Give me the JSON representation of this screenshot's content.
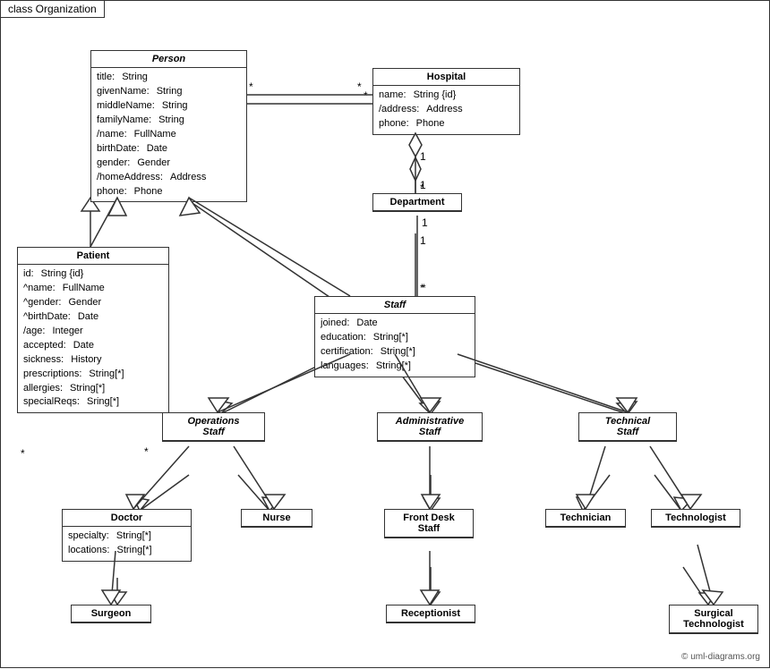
{
  "title": "class Organization",
  "classes": {
    "person": {
      "name": "Person",
      "italic": true,
      "attrs": [
        [
          "title:",
          "String"
        ],
        [
          "givenName:",
          "String"
        ],
        [
          "middleName:",
          "String"
        ],
        [
          "familyName:",
          "String"
        ],
        [
          "/name:",
          "FullName"
        ],
        [
          "birthDate:",
          "Date"
        ],
        [
          "gender:",
          "Gender"
        ],
        [
          "/homeAddress:",
          "Address"
        ],
        [
          "phone:",
          "Phone"
        ]
      ]
    },
    "hospital": {
      "name": "Hospital",
      "italic": false,
      "attrs": [
        [
          "name:",
          "String {id}"
        ],
        [
          "/address:",
          "Address"
        ],
        [
          "phone:",
          "Phone"
        ]
      ]
    },
    "patient": {
      "name": "Patient",
      "italic": false,
      "attrs": [
        [
          "id:",
          "String {id}"
        ],
        [
          "^name:",
          "FullName"
        ],
        [
          "^gender:",
          "Gender"
        ],
        [
          "^birthDate:",
          "Date"
        ],
        [
          "/age:",
          "Integer"
        ],
        [
          "accepted:",
          "Date"
        ],
        [
          "sickness:",
          "History"
        ],
        [
          "prescriptions:",
          "String[*]"
        ],
        [
          "allergies:",
          "String[*]"
        ],
        [
          "specialReqs:",
          "Sring[*]"
        ]
      ]
    },
    "department": {
      "name": "Department",
      "italic": false,
      "attrs": []
    },
    "staff": {
      "name": "Staff",
      "italic": true,
      "attrs": [
        [
          "joined:",
          "Date"
        ],
        [
          "education:",
          "String[*]"
        ],
        [
          "certification:",
          "String[*]"
        ],
        [
          "languages:",
          "String[*]"
        ]
      ]
    },
    "operations_staff": {
      "name": "Operations\nStaff",
      "italic": true,
      "attrs": []
    },
    "administrative_staff": {
      "name": "Administrative\nStaff",
      "italic": true,
      "attrs": []
    },
    "technical_staff": {
      "name": "Technical\nStaff",
      "italic": true,
      "attrs": []
    },
    "doctor": {
      "name": "Doctor",
      "italic": false,
      "attrs": [
        [
          "specialty:",
          "String[*]"
        ],
        [
          "locations:",
          "String[*]"
        ]
      ]
    },
    "nurse": {
      "name": "Nurse",
      "italic": false,
      "attrs": []
    },
    "front_desk_staff": {
      "name": "Front Desk\nStaff",
      "italic": false,
      "attrs": []
    },
    "technician": {
      "name": "Technician",
      "italic": false,
      "attrs": []
    },
    "technologist": {
      "name": "Technologist",
      "italic": false,
      "attrs": []
    },
    "surgeon": {
      "name": "Surgeon",
      "italic": false,
      "attrs": []
    },
    "receptionist": {
      "name": "Receptionist",
      "italic": false,
      "attrs": []
    },
    "surgical_technologist": {
      "name": "Surgical\nTechnologist",
      "italic": false,
      "attrs": []
    }
  },
  "copyright": "© uml-diagrams.org"
}
